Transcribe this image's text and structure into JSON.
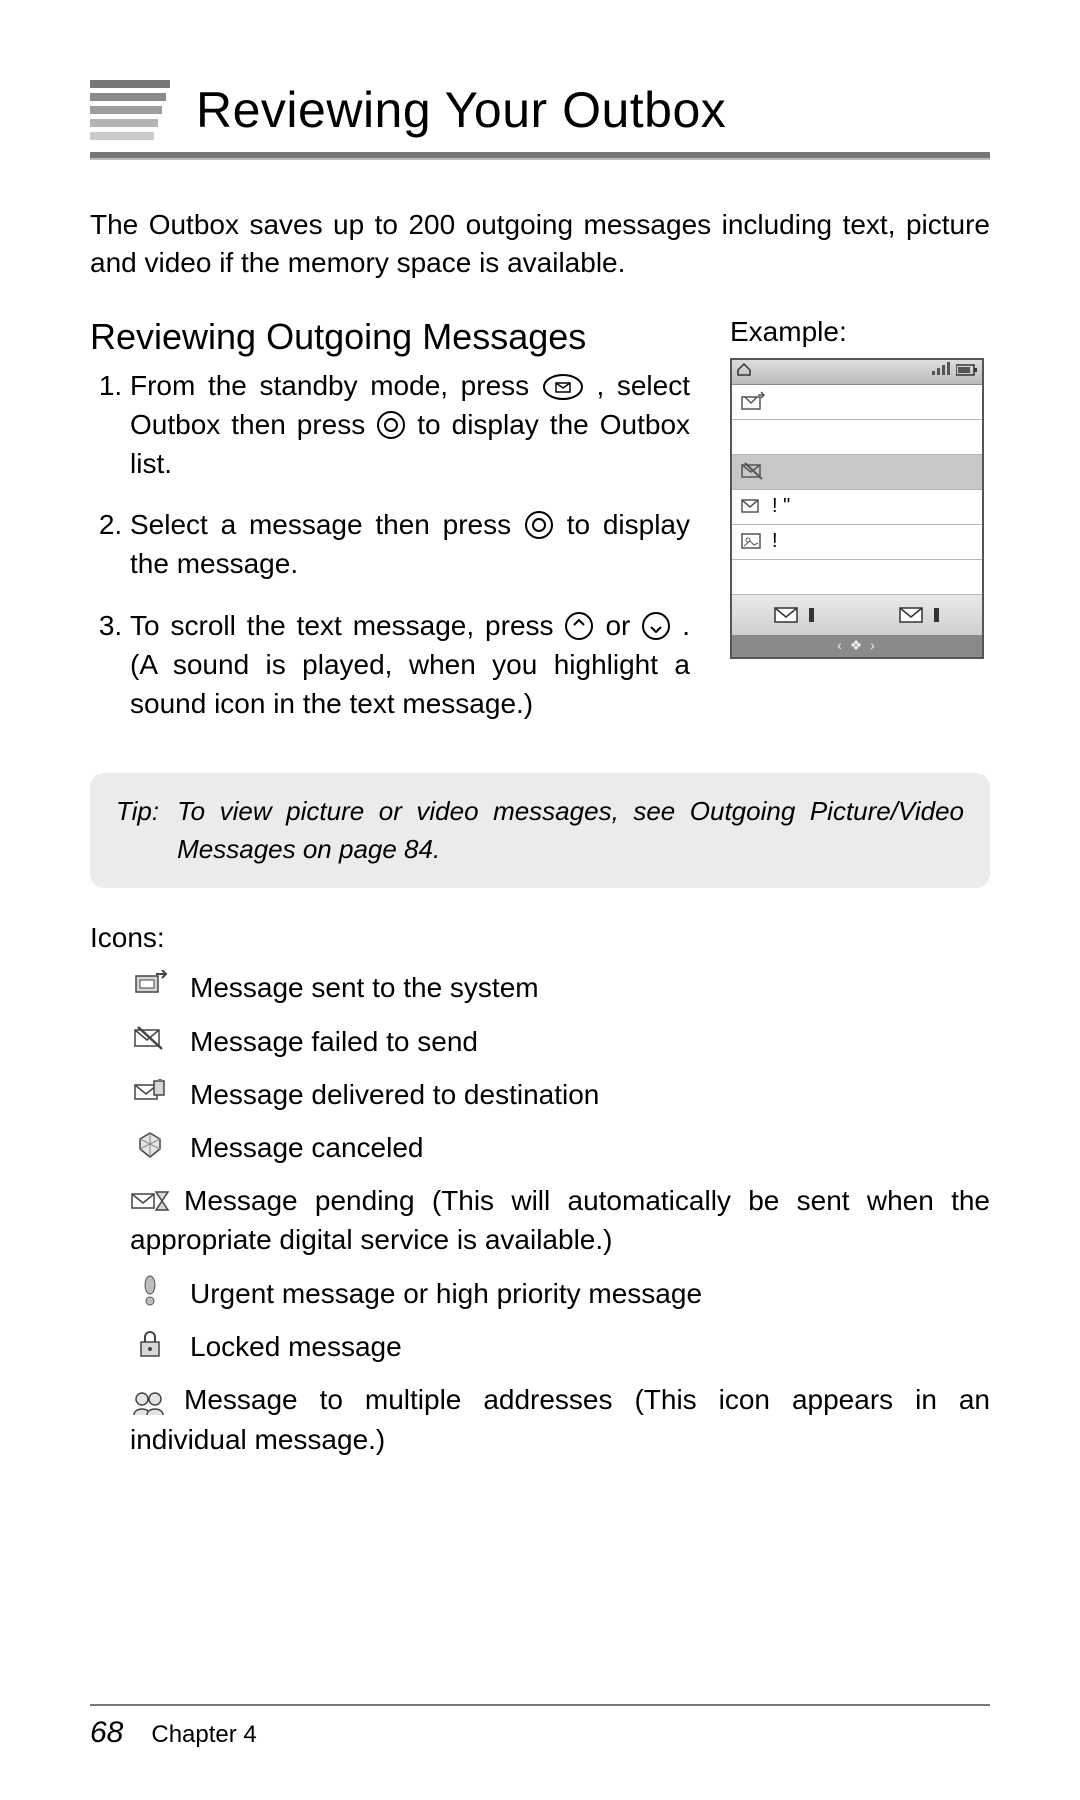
{
  "header": {
    "title": "Reviewing Your Outbox"
  },
  "intro": "The Outbox saves up to 200 outgoing messages including text, picture and video if the memory space is available.",
  "section": {
    "heading": "Reviewing Outgoing Messages",
    "example_label": "Example:",
    "steps": {
      "s1a": "From the standby mode, press ",
      "s1b": ", select Outbox  then press ",
      "s1c": " to display the Outbox list.",
      "s2a": "Select a message then press ",
      "s2b": " to display the message.",
      "s3a": "To scroll the text message, press ",
      "s3b": " or ",
      "s3c": ". (A sound is played, when you highlight a sound icon in the text message.)"
    }
  },
  "phone": {
    "row2_text": "! \"",
    "row3_text": "!",
    "arrows": "‹ ❖ ›"
  },
  "tip": {
    "label": "Tip:",
    "body": "To view picture or video messages, see  Outgoing Picture/Video Messages  on page 84."
  },
  "icons": {
    "label": "Icons:",
    "items": [
      {
        "name": "sent-system-icon",
        "desc": "Message sent to the system"
      },
      {
        "name": "failed-send-icon",
        "desc": "Message failed to send"
      },
      {
        "name": "delivered-icon",
        "desc": "Message delivered to destination"
      },
      {
        "name": "canceled-icon",
        "desc": "Message canceled"
      },
      {
        "name": "pending-icon",
        "desc": "Message pending (This will automatically be sent when the appropriate digital service is available.)"
      },
      {
        "name": "urgent-icon",
        "desc": "Urgent message or high priority message"
      },
      {
        "name": "locked-icon",
        "desc": "Locked message"
      },
      {
        "name": "multi-address-icon",
        "desc": "Message to multiple addresses (This icon appears in an individual message.)"
      }
    ]
  },
  "footer": {
    "page_number": "68",
    "chapter": "Chapter 4"
  }
}
